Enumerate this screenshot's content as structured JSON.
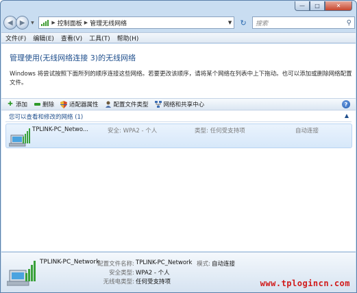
{
  "navbar": {
    "breadcrumb": [
      "控制面板",
      "管理无线网络"
    ],
    "search_placeholder": "搜索"
  },
  "menu": [
    "文件(F)",
    "编辑(E)",
    "查看(V)",
    "工具(T)",
    "帮助(H)"
  ],
  "header": {
    "title": "管理使用(无线网络连接 3)的无线网络",
    "description": "Windows 将尝试按照下面所列的顺序连接这些网络。若要更改该顺序，请将某个网络在列表中上下拖动。也可以添加或删除网络配置文件。"
  },
  "toolbar": {
    "add": "添加",
    "remove": "删除",
    "adapter": "适配器属性",
    "profile_type": "配置文件类型",
    "network_center": "网络和共享中心",
    "help": "?"
  },
  "group": {
    "title": "您可以查看和修改的网络 (1)"
  },
  "networks": [
    {
      "name": "TPLINK-PC_Netwo...",
      "security": "安全: WPA2 - 个人",
      "type": "类型: 任何受支持项",
      "mode": "自动连接"
    }
  ],
  "details": {
    "name": "TPLINK-PC_Network",
    "profile_label": "配置文件名称:",
    "profile_value": "TPLINK-PC_Network",
    "mode_label": "模式:",
    "mode_value": "自动连接",
    "security_label": "安全类型:",
    "security_value": "WPA2 - 个人",
    "radio_label": "无线电类型:",
    "radio_value": "任何受支持项"
  },
  "watermark": "www.tplogincn.com",
  "colors": {
    "title_blue": "#1e4e8c",
    "watermark_red": "#d11a1a",
    "selection_bg": "#d7e8fa"
  }
}
